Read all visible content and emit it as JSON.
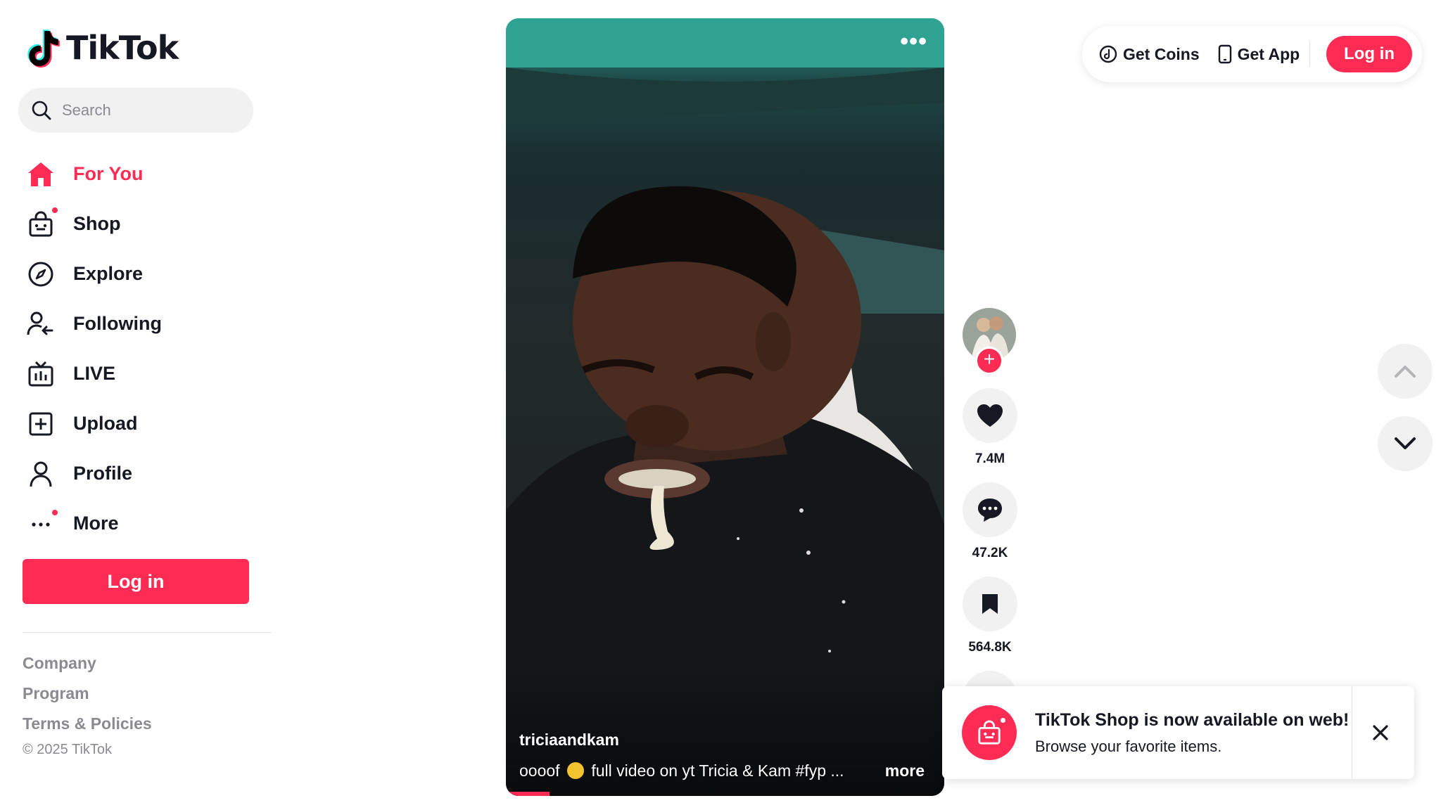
{
  "app": {
    "name": "TikTok",
    "brand_color": "#fe2c55"
  },
  "search": {
    "placeholder": "Search"
  },
  "sidebar": {
    "items": [
      {
        "label": "For You",
        "icon": "home-icon",
        "active": true
      },
      {
        "label": "Shop",
        "icon": "shop-bag-icon",
        "badge": true
      },
      {
        "label": "Explore",
        "icon": "compass-icon"
      },
      {
        "label": "Following",
        "icon": "following-icon"
      },
      {
        "label": "LIVE",
        "icon": "live-tv-icon"
      },
      {
        "label": "Upload",
        "icon": "upload-plus-icon"
      },
      {
        "label": "Profile",
        "icon": "profile-icon"
      },
      {
        "label": "More",
        "icon": "more-dots-icon",
        "badge": true
      }
    ],
    "login_label": "Log in",
    "footer": {
      "links": [
        "Company",
        "Program",
        "Terms & Policies"
      ],
      "copyright": "© 2025 TikTok"
    }
  },
  "header": {
    "get_coins": "Get Coins",
    "get_app": "Get App",
    "login_label": "Log in"
  },
  "video": {
    "author": "triciaandkam",
    "caption_before": "oooof",
    "caption_after": "full video on yt Tricia & Kam #fyp  ...",
    "more_label": "more",
    "progress": 0.1
  },
  "actions": {
    "likes": "7.4M",
    "comments": "47.2K",
    "saves": "564.8K"
  },
  "toast": {
    "title": "TikTok Shop is now available on web!",
    "subtitle": "Browse your favorite items."
  }
}
